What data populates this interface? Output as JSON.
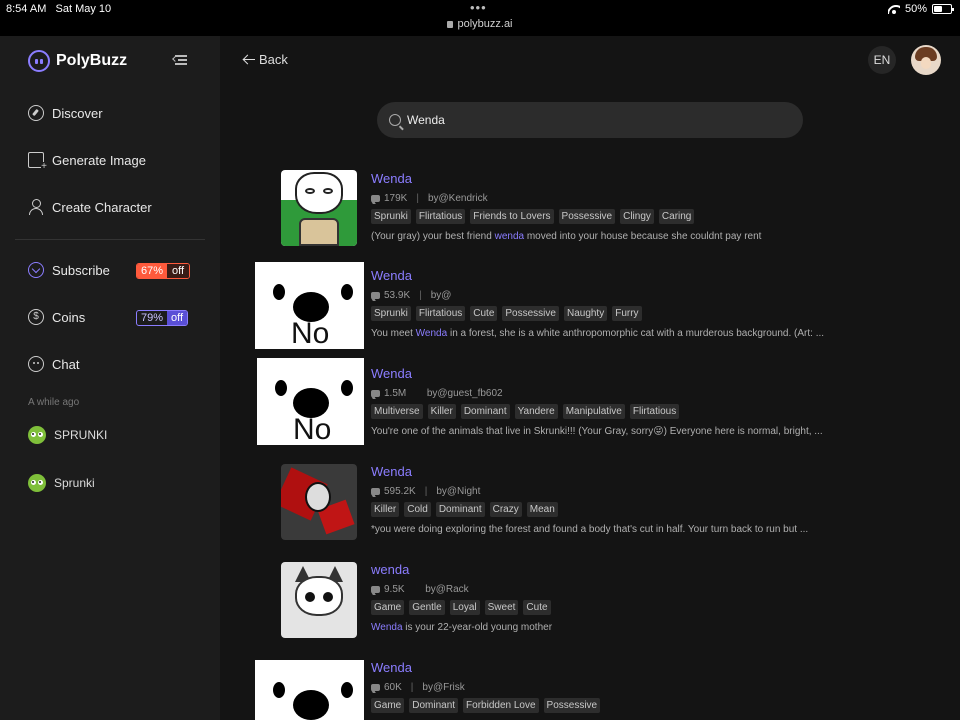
{
  "status_bar": {
    "time": "8:54 AM",
    "date": "Sat May 10",
    "url": "polybuzz.ai",
    "battery": "50%"
  },
  "sidebar": {
    "brand": "PolyBuzz",
    "nav": [
      {
        "label": "Discover",
        "icon": "compass-icon"
      },
      {
        "label": "Generate Image",
        "icon": "image-plus-icon"
      },
      {
        "label": "Create Character",
        "icon": "person-plus-icon"
      }
    ],
    "subscribe": {
      "label": "Subscribe",
      "pct": "67%",
      "off": "off"
    },
    "coins": {
      "label": "Coins",
      "pct": "79%",
      "off": "off"
    },
    "chat": {
      "label": "Chat"
    },
    "recent_label": "A while ago",
    "recent": [
      {
        "label": "SPRUNKI"
      },
      {
        "label": "Sprunki"
      }
    ]
  },
  "header": {
    "back_label": "Back",
    "lang": "EN"
  },
  "search": {
    "value": "Wenda"
  },
  "results": [
    {
      "title": "Wenda",
      "count": "179K",
      "author": "by@Kendrick",
      "tags": [
        "Sprunki",
        "Flirtatious",
        "Friends to Lovers",
        "Possessive",
        "Clingy",
        "Caring"
      ],
      "desc_pre": "(Your gray) your best friend ",
      "desc_hl": "wenda",
      "desc_post": " moved into your house because she couldnt pay rent"
    },
    {
      "title": "Wenda",
      "count": "53.9K",
      "author": "by@",
      "tags": [
        "Sprunki",
        "Flirtatious",
        "Cute",
        "Possessive",
        "Naughty",
        "Furry"
      ],
      "desc_pre": "You meet ",
      "desc_hl": "Wenda",
      "desc_post": " in a forest, she is a white anthropomorphic cat with a murderous background. (Art: ...",
      "thumb_text": "No"
    },
    {
      "title": "Wenda",
      "count": "1.5M",
      "author": "by@guest_fb602",
      "tags": [
        "Multiverse",
        "Killer",
        "Dominant",
        "Yandere",
        "Manipulative",
        "Flirtatious"
      ],
      "desc_pre": "You're one of the animals that live in Skrunki!!! (Your Gray, sorry😜) Everyone here is normal, bright, ...",
      "desc_hl": "",
      "desc_post": "",
      "thumb_text": "No"
    },
    {
      "title": "Wenda",
      "count": "595.2K",
      "author": "by@Night",
      "tags": [
        "Killer",
        "Cold",
        "Dominant",
        "Crazy",
        "Mean"
      ],
      "desc_pre": "*you were doing exploring the forest and found a body that's cut in half. Your turn back to run but ...",
      "desc_hl": "",
      "desc_post": ""
    },
    {
      "title": "wenda",
      "count": "9.5K",
      "author": "by@Rack",
      "tags": [
        "Game",
        "Gentle",
        "Loyal",
        "Sweet",
        "Cute"
      ],
      "desc_pre": "",
      "desc_hl": "Wenda",
      "desc_post": " is your 22-year-old young mother"
    },
    {
      "title": "Wenda",
      "count": "60K",
      "author": "by@Frisk",
      "tags": [
        "Game",
        "Dominant",
        "Forbidden Love",
        "Possessive"
      ],
      "desc_pre": "",
      "desc_hl": "",
      "desc_post": ""
    }
  ],
  "colors": {
    "accent": "#8b7dff",
    "subscribe_badge": "#ff5a3c",
    "background": "#141414",
    "sidebar": "#1c1c1c"
  }
}
